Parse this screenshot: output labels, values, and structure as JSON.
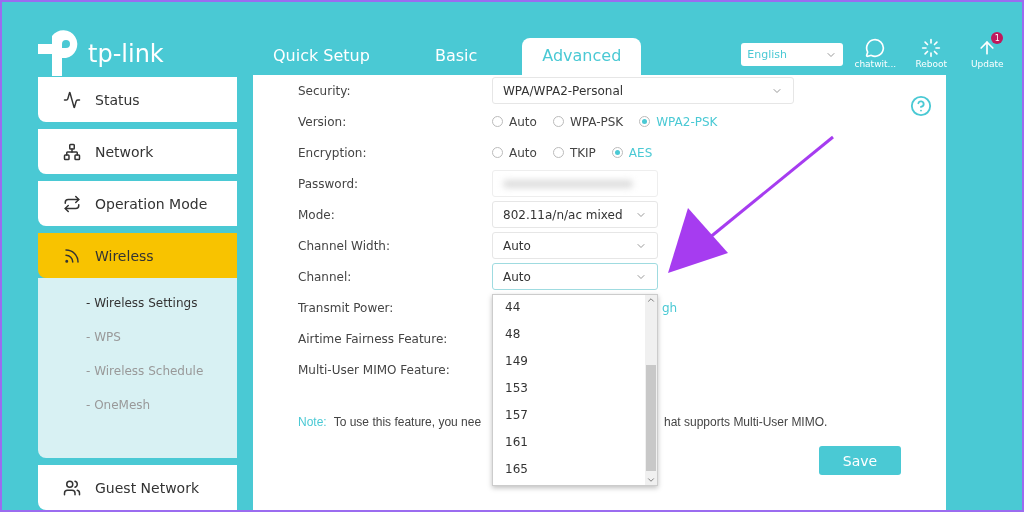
{
  "logo": {
    "text": "tp-link"
  },
  "tabs": [
    {
      "label": "Quick Setup",
      "selected": false
    },
    {
      "label": "Basic",
      "selected": false
    },
    {
      "label": "Advanced",
      "selected": true
    }
  ],
  "language": {
    "value": "English"
  },
  "header_actions": [
    {
      "kind": "chat",
      "label": "chatwit..."
    },
    {
      "kind": "reboot",
      "label": "Reboot"
    },
    {
      "kind": "update",
      "label": "Update",
      "badge": "1"
    }
  ],
  "sidebar": {
    "items": [
      {
        "kind": "status",
        "label": "Status",
        "selected": false
      },
      {
        "kind": "network",
        "label": "Network",
        "selected": false
      },
      {
        "kind": "mode",
        "label": "Operation Mode",
        "selected": false
      },
      {
        "kind": "wireless",
        "label": "Wireless",
        "selected": true,
        "children": [
          {
            "label": "- Wireless Settings",
            "selected": true
          },
          {
            "label": "- WPS",
            "selected": false
          },
          {
            "label": "- Wireless Schedule",
            "selected": false
          },
          {
            "label": "- OneMesh",
            "selected": false
          }
        ]
      },
      {
        "kind": "guest",
        "label": "Guest Network",
        "selected": false
      }
    ]
  },
  "form": {
    "rows": [
      {
        "kind": "select",
        "label": "Security:",
        "value": "WPA/WPA2-Personal",
        "wide": true,
        "focused": false
      },
      {
        "kind": "radio",
        "label": "Version:",
        "options": [
          {
            "label": "Auto",
            "selected": false
          },
          {
            "label": "WPA-PSK",
            "selected": false
          },
          {
            "label": "WPA2-PSK",
            "selected": true
          }
        ]
      },
      {
        "kind": "radio",
        "label": "Encryption:",
        "options": [
          {
            "label": "Auto",
            "selected": false
          },
          {
            "label": "TKIP",
            "selected": false
          },
          {
            "label": "AES",
            "selected": true
          }
        ]
      },
      {
        "kind": "password",
        "label": "Password:",
        "blurred": true
      },
      {
        "kind": "select",
        "label": "Mode:",
        "value": "802.11a/n/ac mixed",
        "wide": false,
        "focused": false
      },
      {
        "kind": "select",
        "label": "Channel Width:",
        "value": "Auto",
        "wide": false,
        "focused": false
      },
      {
        "kind": "select",
        "label": "Channel:",
        "value": "Auto",
        "wide": false,
        "focused": true,
        "open_list": [
          "44",
          "48",
          "149",
          "153",
          "157",
          "161",
          "165"
        ]
      },
      {
        "kind": "partial",
        "label": "Transmit Power:",
        "value": "gh"
      },
      {
        "kind": "label_only",
        "label": "Airtime Fairness Feature:"
      },
      {
        "kind": "label_only",
        "label": "Multi-User MIMO Feature:"
      }
    ],
    "note": {
      "label": "Note:",
      "text_left": "To use this feature, you nee",
      "text_right": "hat supports Multi-User MIMO."
    },
    "save": "Save"
  }
}
